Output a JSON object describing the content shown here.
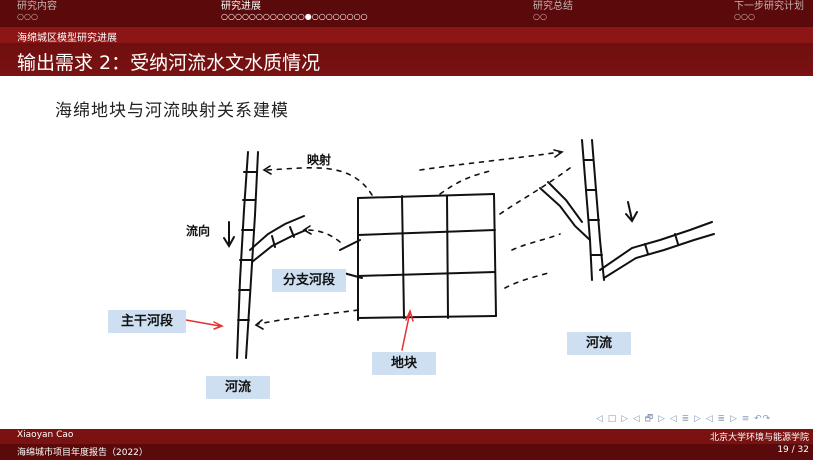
{
  "nav": {
    "sections": [
      {
        "label": "研究内容",
        "dots": "○○○"
      },
      {
        "label": "研究进展",
        "dots": "○○○○○○○○○○○○●○○○○○○○○"
      },
      {
        "label": "研究总结",
        "dots": "○○"
      },
      {
        "label": "下一步研究计划",
        "dots": "○○○"
      }
    ]
  },
  "header": {
    "subsection": "海绵城区模型研究进展",
    "frame_title": "输出需求 2：受纳河流水文水质情况"
  },
  "content": {
    "heading": "海绵地块与河流映射关系建模",
    "labels": {
      "mapping": "映射",
      "flow_direction": "流向",
      "branch_segment": "分支河段",
      "main_segment": "主干河段",
      "river_left": "河流",
      "parcel": "地块",
      "river_right": "河流"
    }
  },
  "beamer_nav": "◁ □ ▷ ◁ 🗗 ▷ ◁ ≣ ▷ ◁ ≣ ▷ ≡ ↶↷",
  "footer": {
    "author": "Xiaoyan Cao",
    "institute": "北京大学环境与能源学院",
    "short_title": "海绵城市项目年度报告（2022）",
    "page": "19 / 32"
  }
}
